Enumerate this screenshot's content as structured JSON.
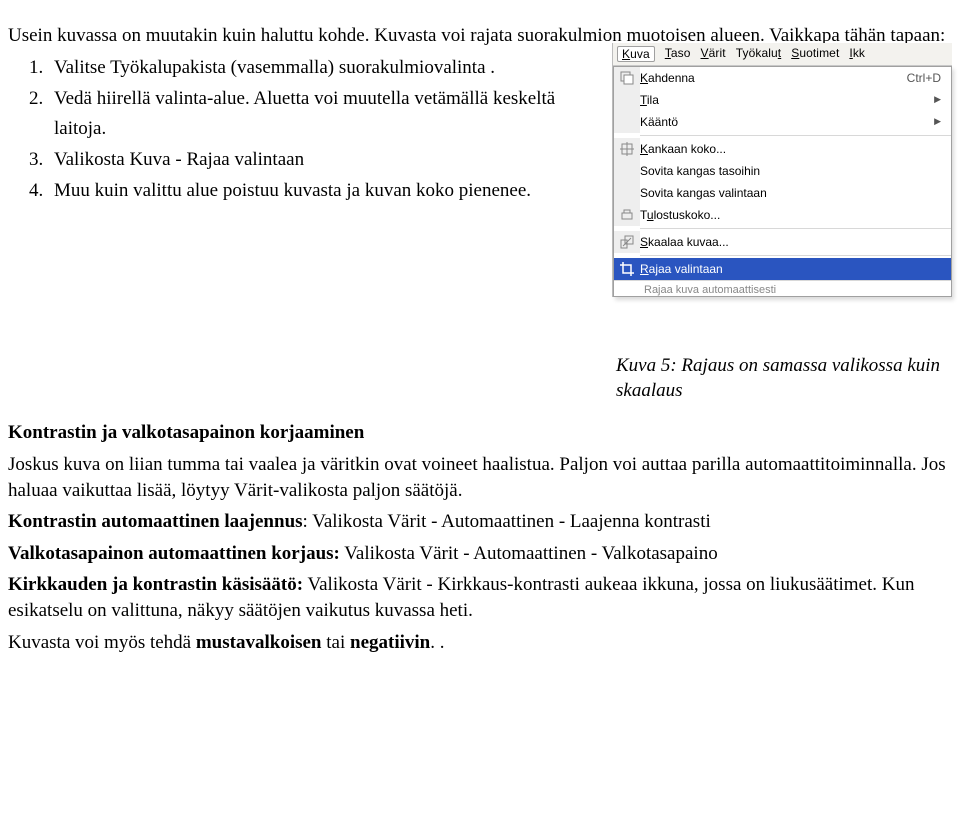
{
  "intro_p1": "Usein kuvassa on muutakin kuin haluttu kohde. Kuvasta voi rajata suorakulmion muotoisen alueen. Vaikkapa tähän tapaan:",
  "steps": [
    "Valitse Työkalupakista (vasemmalla) suorakulmiovalinta .",
    "Vedä hiirellä valinta-alue. Aluetta voi muutella vetämällä keskeltä laitoja.",
    "Valikosta Kuva - Rajaa valintaan",
    "Muu kuin valittu alue poistuu kuvasta ja kuvan koko pienenee."
  ],
  "menu": {
    "menubar": [
      "Kuva",
      "Taso",
      "Värit",
      "Työkalut",
      "Suotimet",
      "Ikk"
    ],
    "menubar_underline": [
      "K",
      "T",
      "V",
      "T",
      "S",
      "I"
    ],
    "items": [
      {
        "label": "Kahdenna",
        "shortcut": "Ctrl+D",
        "arrow": false,
        "icon": "duplicate"
      },
      {
        "label": "Tila",
        "arrow": true
      },
      {
        "label": "Kääntö",
        "arrow": true
      },
      {
        "sep": true
      },
      {
        "label": "Kankaan koko...",
        "icon": "canvas"
      },
      {
        "label": "Sovita kangas tasoihin"
      },
      {
        "label": "Sovita kangas valintaan"
      },
      {
        "label": "Tulostuskoko...",
        "icon": "print"
      },
      {
        "sep": true
      },
      {
        "label": "Skaalaa kuvaa...",
        "icon": "scale"
      },
      {
        "sep": true
      },
      {
        "label": "Rajaa valintaan",
        "highlight": true,
        "icon": "crop"
      }
    ],
    "partial": "Rajaa kuva automaattisesti"
  },
  "caption": "Kuva 5: Rajaus on samassa valikossa kuin skaalaus",
  "section2_title": "Kontrastin ja valkotasapainon korjaaminen",
  "p2": "Joskus kuva on liian tumma tai vaalea ja väritkin ovat voineet haalistua. Paljon voi auttaa parilla automaattitoiminnalla. Jos haluaa vaikuttaa lisää, löytyy Värit-valikosta paljon säätöjä.",
  "p3_bold": "Kontrastin automaattinen laajennus",
  "p3_rest": ": Valikosta Värit - Automaattinen - Laajenna kontrasti",
  "p4_bold": "Valkotasapainon automaattinen korjaus:",
  "p4_rest": " Valikosta Värit - Automaattinen - Valkotasapaino",
  "p5_bold": "Kirkkauden ja kontrastin käsisäätö:",
  "p5_rest": " Valikosta Värit - Kirkkaus-kontrasti aukeaa ikkuna, jossa on liukusäätimet. Kun esikatselu on valittuna, näkyy säätöjen vaikutus kuvassa heti.",
  "p6_a": "Kuvasta voi myös tehdä ",
  "p6_b": "mustavalkoisen",
  "p6_c": " tai ",
  "p6_d": "negatiivin",
  "p6_e": ". ."
}
